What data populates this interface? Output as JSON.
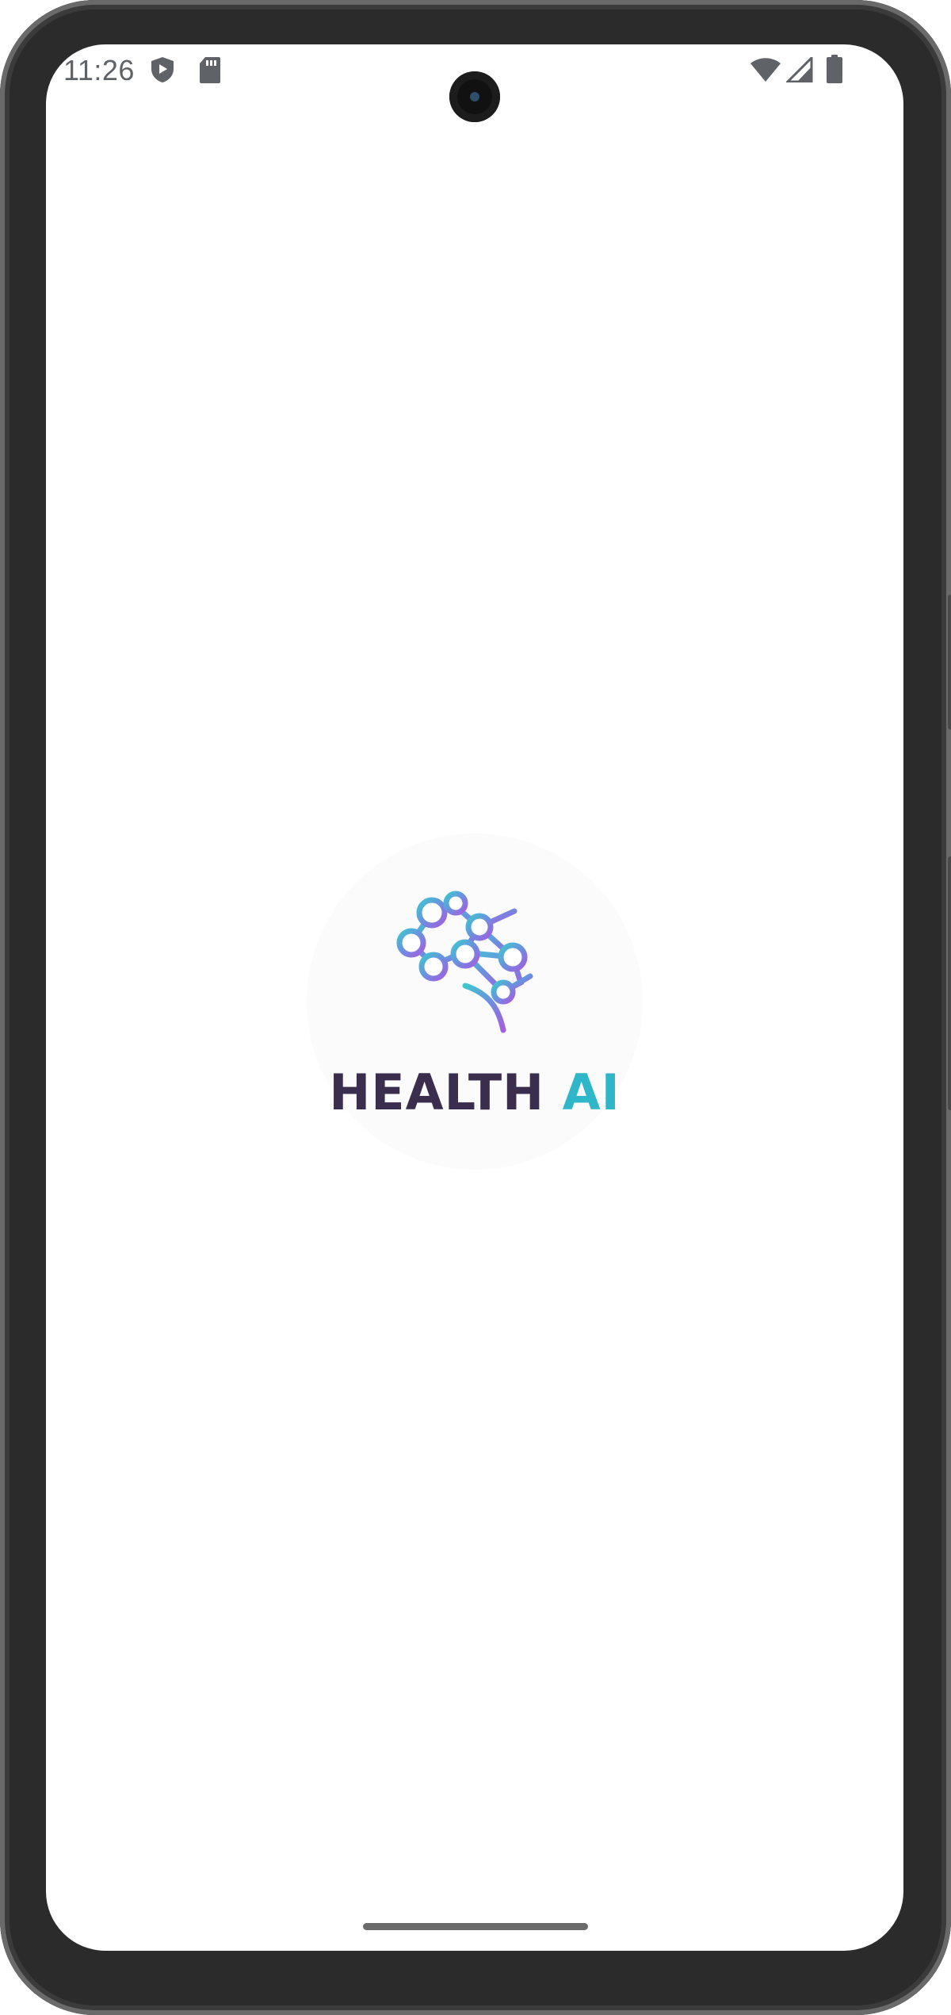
{
  "status_bar": {
    "time": "11:26",
    "icons_left": [
      "shield-play-icon",
      "sd-card-icon"
    ],
    "icons_right": [
      "wifi-icon",
      "cellular-signal-icon",
      "battery-icon"
    ]
  },
  "splash": {
    "logo_icon": "neural-brain-icon",
    "brand_word": "HEALTH",
    "brand_ai": "AI",
    "colors": {
      "brand_dark": "#3a2d4d",
      "gradient_start": "#3ec6d0",
      "gradient_mid": "#6c8fe0",
      "gradient_end": "#a35ee0"
    }
  }
}
